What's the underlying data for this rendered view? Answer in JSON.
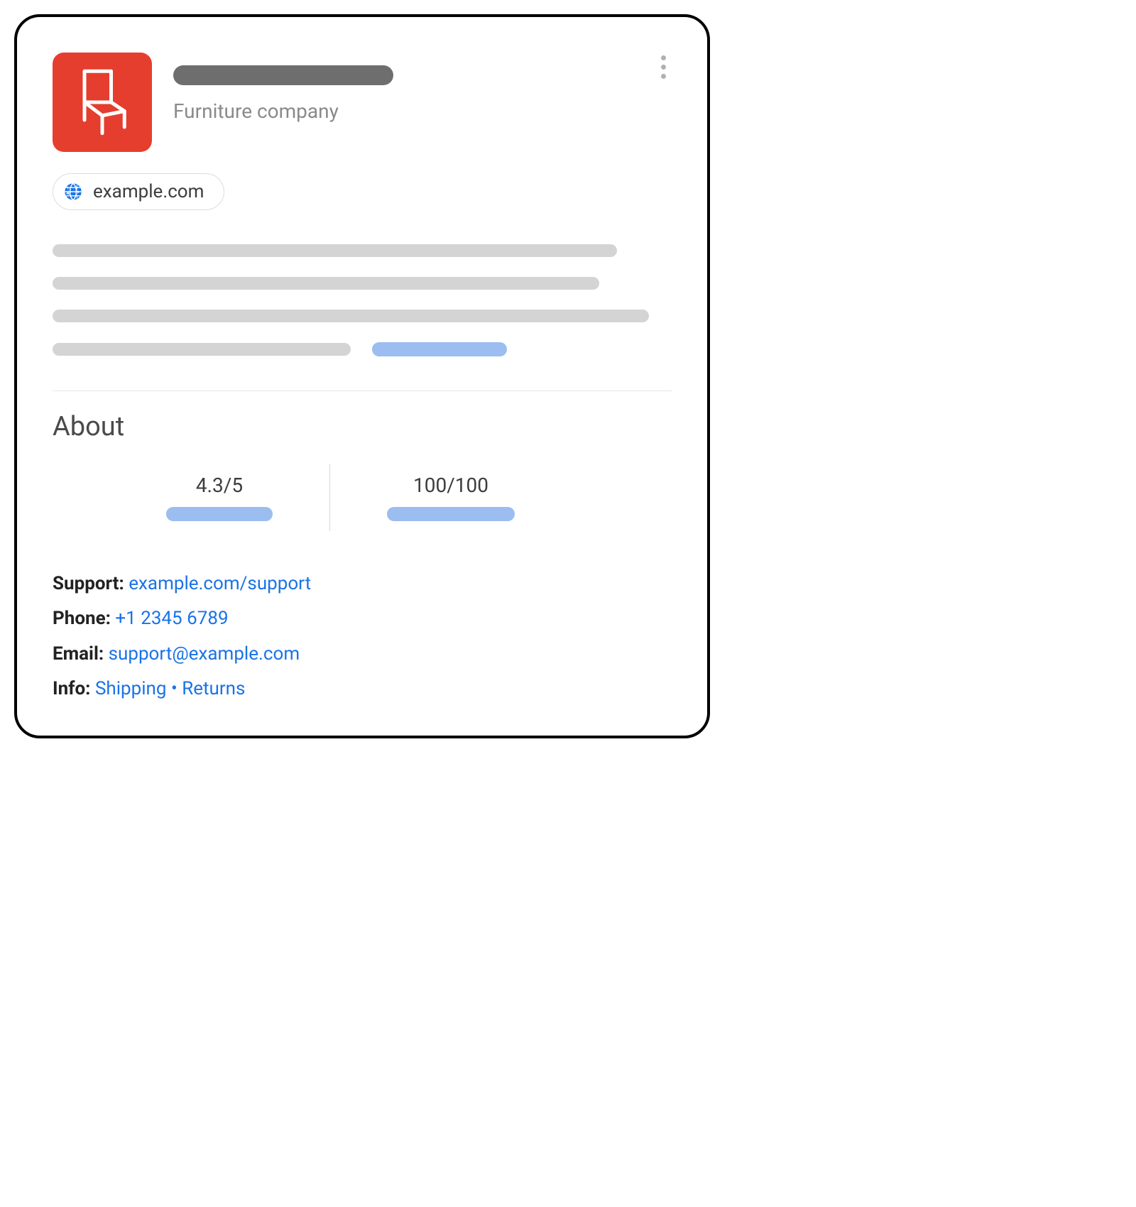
{
  "header": {
    "subtitle": "Furniture company",
    "site_chip": "example.com"
  },
  "about": {
    "heading": "About",
    "rating": "4.3/5",
    "score": "100/100"
  },
  "contact": {
    "support_label": "Support:",
    "support_link": "example.com/support",
    "phone_label": "Phone:",
    "phone_link": "+1 2345 6789",
    "email_label": "Email:",
    "email_link": "support@example.com",
    "info_label": "Info:",
    "info_shipping": "Shipping",
    "info_sep": " • ",
    "info_returns": "Returns"
  }
}
